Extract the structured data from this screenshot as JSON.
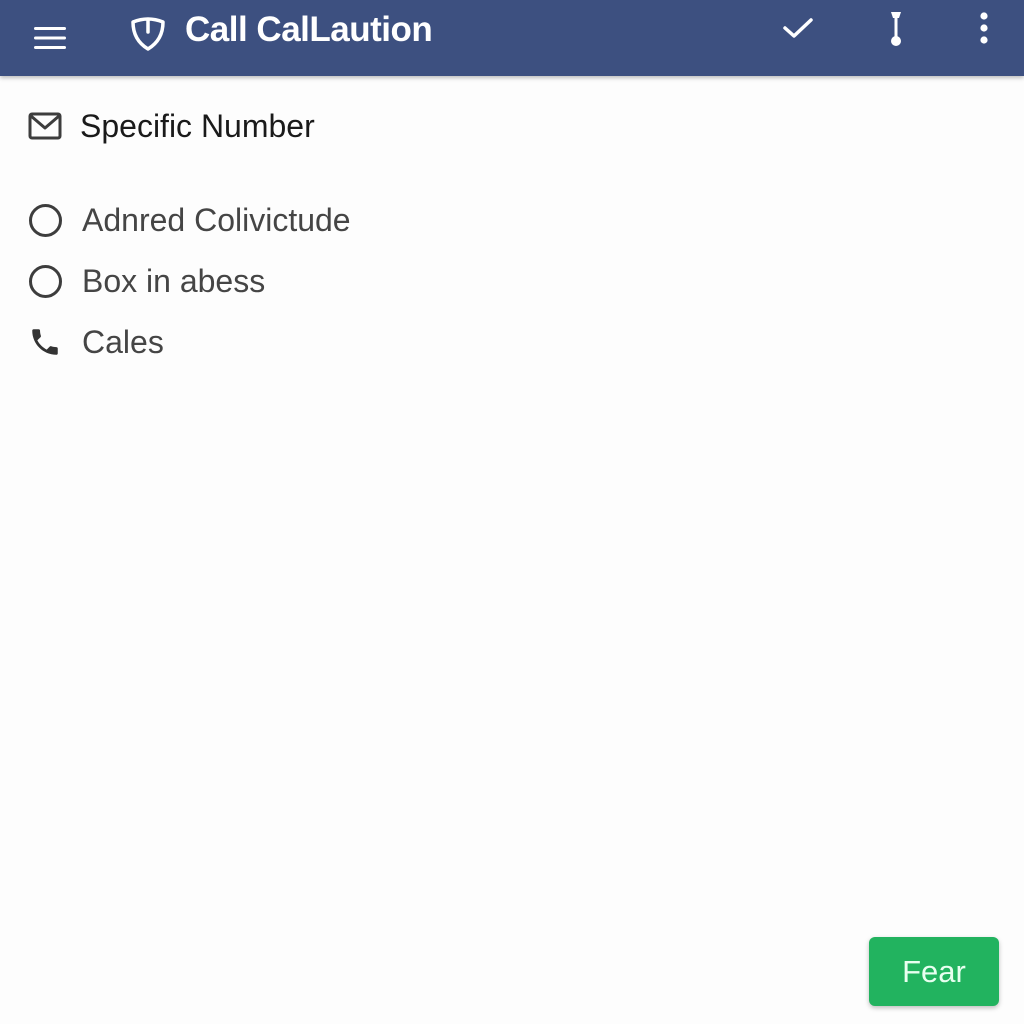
{
  "appbar": {
    "title": "Call CalLaution",
    "menu_icon": "hamburger-menu-icon",
    "brand_icon": "shield-icon",
    "actions": [
      {
        "name": "check-icon"
      },
      {
        "name": "drag-handle-icon"
      },
      {
        "name": "more-vert-icon"
      }
    ],
    "background": "#3d5080"
  },
  "list": {
    "header": {
      "label": "Specific Number",
      "icon": "mail-icon"
    },
    "items": [
      {
        "label": "Adnred Colivictude",
        "icon": "radio-unchecked-icon",
        "checked": false
      },
      {
        "label": "Box in abess",
        "icon": "radio-unchecked-icon",
        "checked": false
      },
      {
        "label": "Cales",
        "icon": "phone-icon"
      }
    ]
  },
  "action_button": {
    "label": "Fear",
    "color": "#22b35f"
  }
}
